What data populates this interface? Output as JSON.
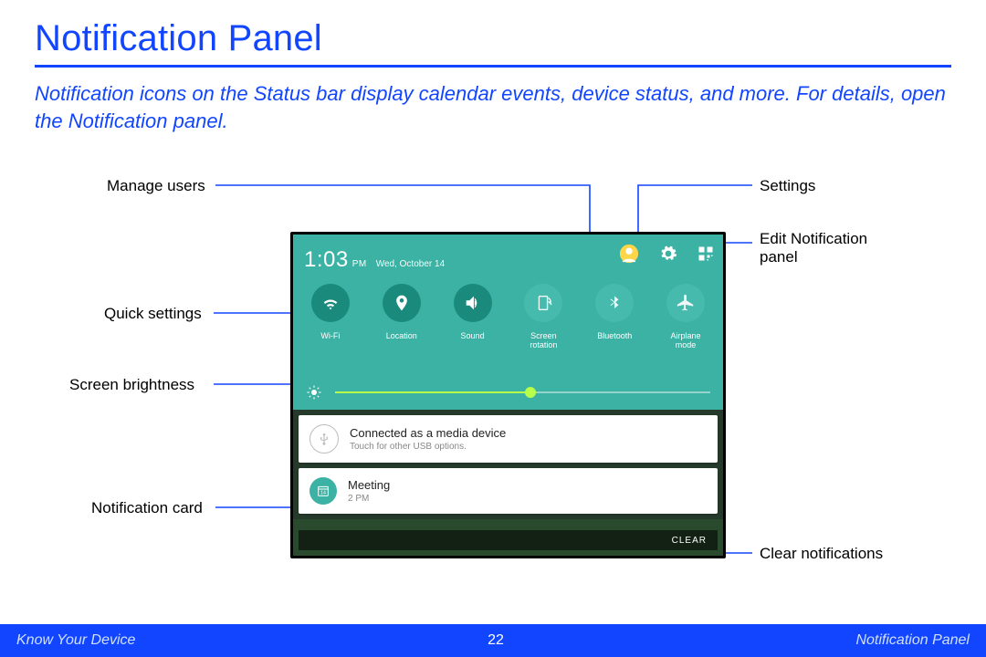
{
  "page": {
    "title": "Notification Panel",
    "intro": "Notification icons on the Status bar display calendar events, device status, and more. For details, open the Notification panel."
  },
  "labels": {
    "manage_users": "Manage users",
    "quick_settings": "Quick settings",
    "screen_brightness": "Screen brightness",
    "notification_card": "Notification card",
    "settings": "Settings",
    "edit_panel_l1": "Edit Notification",
    "edit_panel_l2": "panel",
    "clear_notifications": "Clear notifications"
  },
  "status": {
    "time": "1:03",
    "pm": "PM",
    "date": "Wed, October 14"
  },
  "quick_settings": {
    "wifi": "Wi-Fi",
    "location": "Location",
    "sound": "Sound",
    "screen_rotation_l1": "Screen",
    "screen_rotation_l2": "rotation",
    "bluetooth": "Bluetooth",
    "airplane_l1": "Airplane",
    "airplane_l2": "mode"
  },
  "brightness": {
    "value_percent": 52
  },
  "cards": {
    "usb": {
      "title": "Connected as a media device",
      "sub": "Touch for other USB options."
    },
    "cal": {
      "title": "Meeting",
      "sub": "2 PM"
    }
  },
  "clear": "CLEAR",
  "footer": {
    "left": "Know Your Device",
    "page": "22",
    "right": "Notification Panel"
  }
}
